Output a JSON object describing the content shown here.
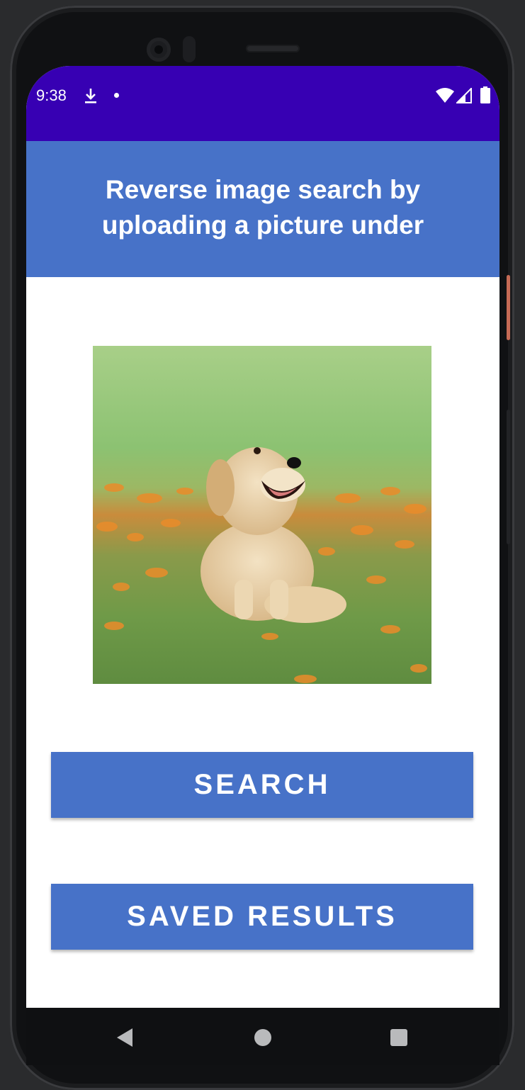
{
  "status_bar": {
    "time": "9:38",
    "icons": [
      "download-icon",
      "notification-dot-icon",
      "wifi-icon",
      "cell-signal-icon",
      "battery-icon"
    ],
    "background": "#3700b3"
  },
  "header": {
    "title": "Reverse image search by uploading a picture under",
    "background": "#4772c8"
  },
  "uploaded_image": {
    "subject": "golden retriever puppy sitting on grass with orange flowers"
  },
  "buttons": {
    "search_label": "SEARCH",
    "saved_results_label": "SAVED RESULTS",
    "color": "#4772c8"
  },
  "nav_bar": {
    "icons": [
      "back-icon",
      "home-icon",
      "recents-icon"
    ]
  }
}
